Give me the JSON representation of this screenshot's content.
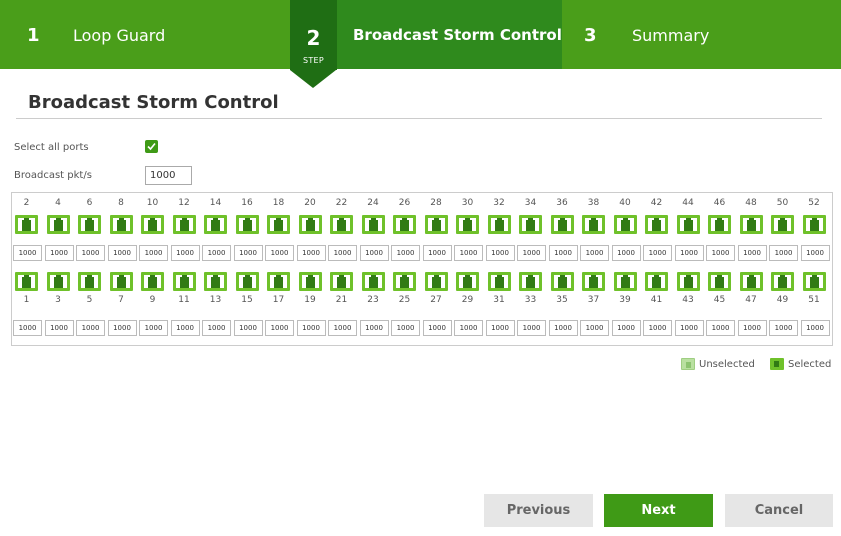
{
  "wizard": {
    "steps": [
      {
        "num": "1",
        "label": "Loop Guard"
      },
      {
        "num": "2",
        "label": "Broadcast Storm Control",
        "badge": "STEP"
      },
      {
        "num": "3",
        "label": "Summary"
      }
    ]
  },
  "page": {
    "title": "Broadcast Storm Control"
  },
  "form": {
    "select_all_label": "Select all ports",
    "select_all_checked": true,
    "broadcast_label": "Broadcast pkt/s",
    "broadcast_value": "1000"
  },
  "ports": {
    "state": "selected",
    "top_row": [
      {
        "port": "2",
        "value": "1000"
      },
      {
        "port": "4",
        "value": "1000"
      },
      {
        "port": "6",
        "value": "1000"
      },
      {
        "port": "8",
        "value": "1000"
      },
      {
        "port": "10",
        "value": "1000"
      },
      {
        "port": "12",
        "value": "1000"
      },
      {
        "port": "14",
        "value": "1000"
      },
      {
        "port": "16",
        "value": "1000"
      },
      {
        "port": "18",
        "value": "1000"
      },
      {
        "port": "20",
        "value": "1000"
      },
      {
        "port": "22",
        "value": "1000"
      },
      {
        "port": "24",
        "value": "1000"
      },
      {
        "port": "26",
        "value": "1000"
      },
      {
        "port": "28",
        "value": "1000"
      },
      {
        "port": "30",
        "value": "1000"
      },
      {
        "port": "32",
        "value": "1000"
      },
      {
        "port": "34",
        "value": "1000"
      },
      {
        "port": "36",
        "value": "1000"
      },
      {
        "port": "38",
        "value": "1000"
      },
      {
        "port": "40",
        "value": "1000"
      },
      {
        "port": "42",
        "value": "1000"
      },
      {
        "port": "44",
        "value": "1000"
      },
      {
        "port": "46",
        "value": "1000"
      },
      {
        "port": "48",
        "value": "1000"
      },
      {
        "port": "50",
        "value": "1000"
      },
      {
        "port": "52",
        "value": "1000"
      }
    ],
    "bottom_row": [
      {
        "port": "1",
        "value": "1000"
      },
      {
        "port": "3",
        "value": "1000"
      },
      {
        "port": "5",
        "value": "1000"
      },
      {
        "port": "7",
        "value": "1000"
      },
      {
        "port": "9",
        "value": "1000"
      },
      {
        "port": "11",
        "value": "1000"
      },
      {
        "port": "13",
        "value": "1000"
      },
      {
        "port": "15",
        "value": "1000"
      },
      {
        "port": "17",
        "value": "1000"
      },
      {
        "port": "19",
        "value": "1000"
      },
      {
        "port": "21",
        "value": "1000"
      },
      {
        "port": "23",
        "value": "1000"
      },
      {
        "port": "25",
        "value": "1000"
      },
      {
        "port": "27",
        "value": "1000"
      },
      {
        "port": "29",
        "value": "1000"
      },
      {
        "port": "31",
        "value": "1000"
      },
      {
        "port": "33",
        "value": "1000"
      },
      {
        "port": "35",
        "value": "1000"
      },
      {
        "port": "37",
        "value": "1000"
      },
      {
        "port": "39",
        "value": "1000"
      },
      {
        "port": "41",
        "value": "1000"
      },
      {
        "port": "43",
        "value": "1000"
      },
      {
        "port": "45",
        "value": "1000"
      },
      {
        "port": "47",
        "value": "1000"
      },
      {
        "port": "49",
        "value": "1000"
      },
      {
        "port": "51",
        "value": "1000"
      }
    ]
  },
  "legend": {
    "unselected": "Unselected",
    "selected": "Selected"
  },
  "buttons": {
    "previous": "Previous",
    "next": "Next",
    "cancel": "Cancel"
  },
  "colors": {
    "header_green": "#4a9e1a",
    "active_step_green": "#2f8a1d",
    "badge_green": "#1f6e14",
    "port_green": "#6fc12a",
    "button_green": "#3f9a16",
    "button_gray": "#e6e6e6"
  },
  "icons": {
    "port": "ethernet-port-icon",
    "check": "checkmark-icon"
  }
}
